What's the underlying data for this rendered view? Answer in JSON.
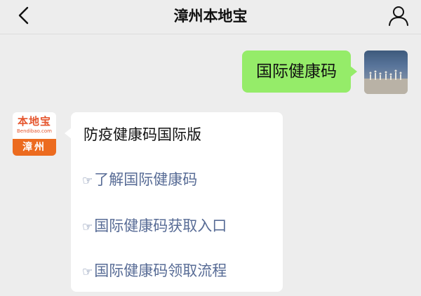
{
  "header": {
    "title": "漳州本地宝"
  },
  "conversation": {
    "sent_message": "国际健康码",
    "bot_avatar": {
      "brand": "本地宝",
      "site": "Bendibao.com",
      "city": "漳州"
    },
    "reply": {
      "headline": "防疫健康码国际版",
      "link_prefix": "☞",
      "links": [
        "了解国际健康码",
        "国际健康码获取入口",
        "国际健康码领取流程"
      ]
    }
  },
  "colors": {
    "sent_bubble": "#95ec69",
    "link": "#576b95",
    "background": "#ededed"
  },
  "icons": {
    "back": "chevron-left",
    "profile": "person-outline"
  }
}
